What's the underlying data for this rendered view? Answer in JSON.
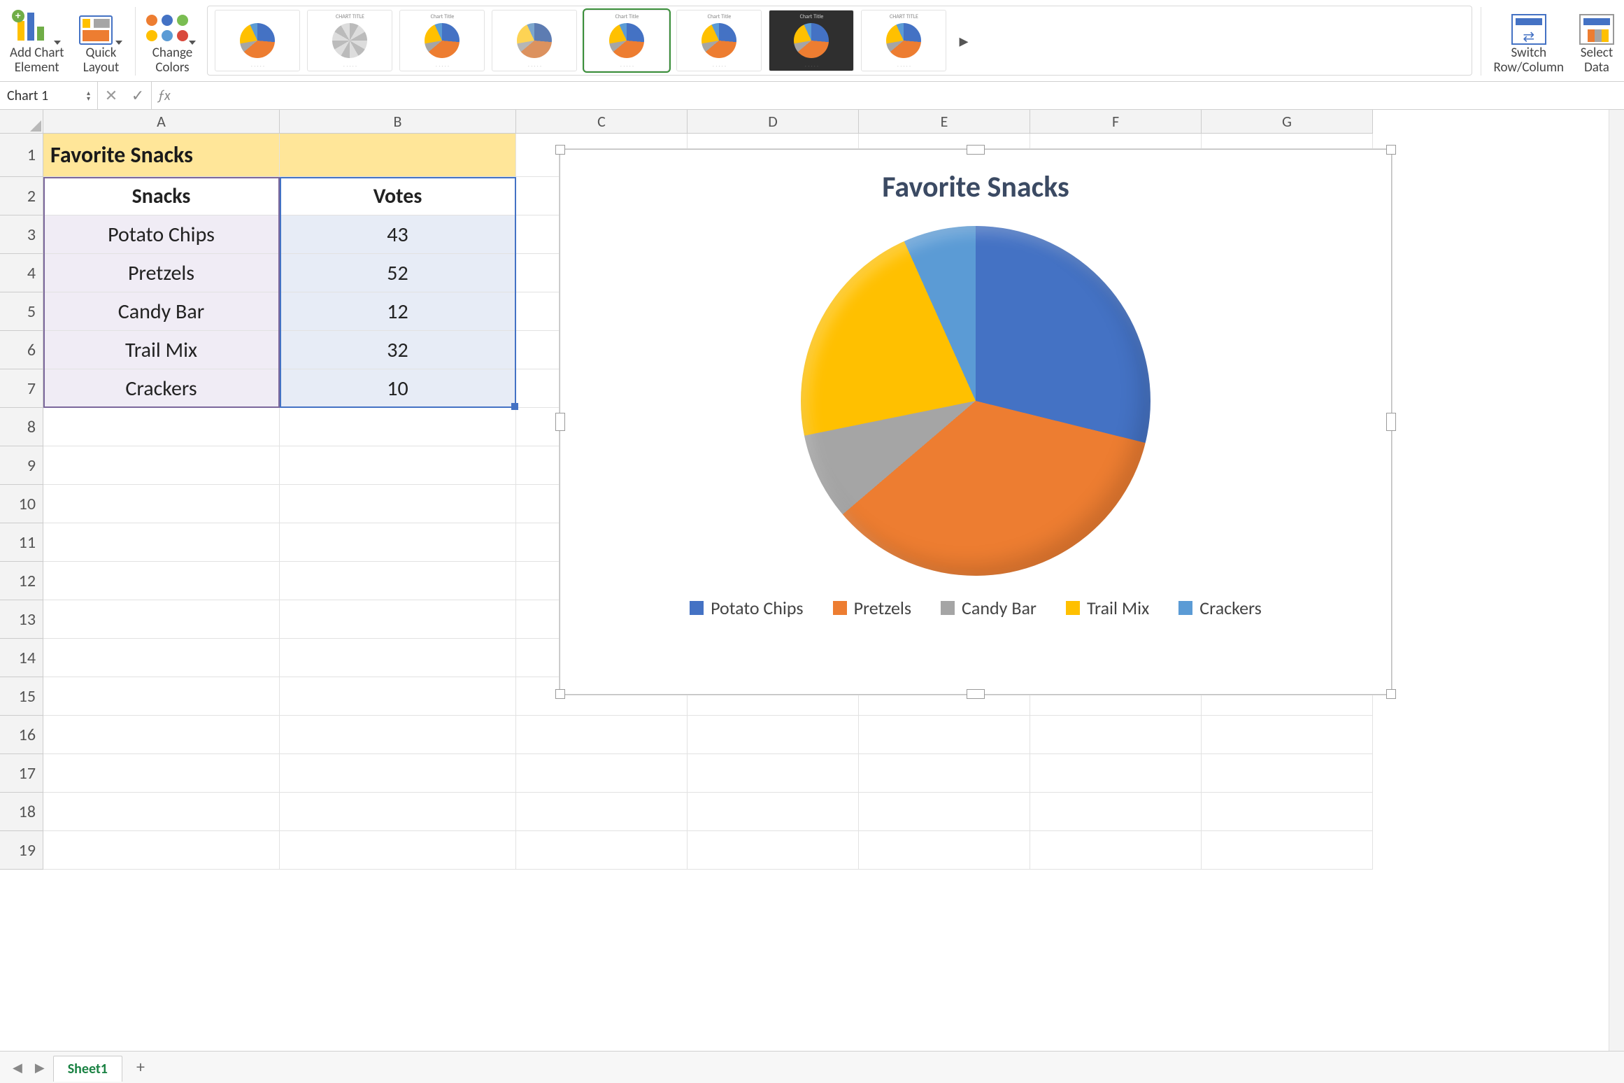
{
  "ribbon": {
    "add_chart_element": "Add Chart\nElement",
    "quick_layout": "Quick\nLayout",
    "change_colors": "Change\nColors",
    "switch_row_col": "Switch\nRow/Column",
    "select_data": "Select\nData",
    "gallery_titles": [
      "",
      "CHART TITLE",
      "Chart Title",
      "",
      "Chart Title",
      "Chart Title",
      "Chart Title",
      "CHART TITLE"
    ],
    "gallery_selected_index": 4
  },
  "name_box": "Chart 1",
  "formula": "",
  "columns": [
    "A",
    "B",
    "C",
    "D",
    "E",
    "F",
    "G"
  ],
  "rows": [
    "1",
    "2",
    "3",
    "4",
    "5",
    "6",
    "7",
    "8",
    "9",
    "10",
    "11",
    "12",
    "13",
    "14",
    "15",
    "16",
    "17",
    "18",
    "19"
  ],
  "title_cell": "Favorite Snacks",
  "headers": {
    "snacks": "Snacks",
    "votes": "Votes"
  },
  "data": [
    {
      "name": "Potato Chips",
      "votes": 43
    },
    {
      "name": "Pretzels",
      "votes": 52
    },
    {
      "name": "Candy Bar",
      "votes": 12
    },
    {
      "name": "Trail Mix",
      "votes": 32
    },
    {
      "name": "Crackers",
      "votes": 10
    }
  ],
  "chart_data": {
    "type": "pie",
    "title": "Favorite Snacks",
    "categories": [
      "Potato Chips",
      "Pretzels",
      "Candy Bar",
      "Trail Mix",
      "Crackers"
    ],
    "values": [
      43,
      52,
      12,
      32,
      10
    ],
    "colors": [
      "#4472c4",
      "#ed7d31",
      "#a5a5a5",
      "#ffc000",
      "#5b9bd5"
    ],
    "legend_position": "bottom"
  },
  "sheet_tab": "Sheet1",
  "colors_palette": [
    "#ed7d31",
    "#4472c4",
    "#7abd52",
    "#ffc000",
    "#5b9bd5",
    "#d94a3d"
  ]
}
